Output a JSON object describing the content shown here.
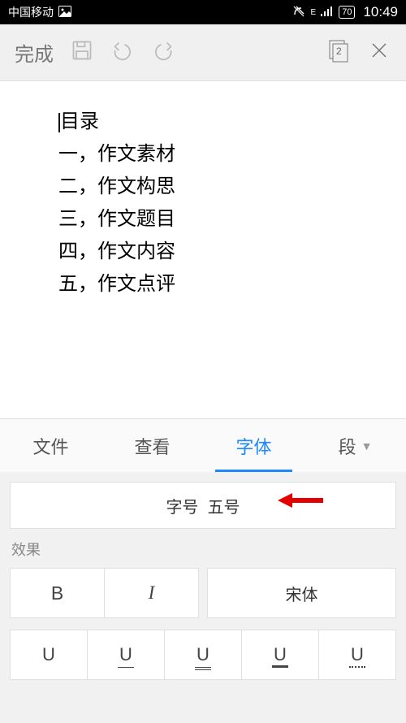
{
  "status_bar": {
    "carrier": "中国移动",
    "battery_text": "70",
    "time": "10:49"
  },
  "toolbar": {
    "done_label": "完成",
    "page_number": "2"
  },
  "document": {
    "lines": [
      "目录",
      "一，作文素材",
      "二，作文构思",
      "三，作文题目",
      "四，作文内容",
      "五，作文点评"
    ]
  },
  "tabs": {
    "items": [
      {
        "label": "文件"
      },
      {
        "label": "查看"
      },
      {
        "label": "字体",
        "active": true
      },
      {
        "label": "段"
      }
    ]
  },
  "font_panel": {
    "size_label": "字号",
    "size_value": "五号",
    "effects_label": "效果",
    "bold": "B",
    "italic": "I",
    "font_family": "宋体",
    "u_label": "U"
  }
}
